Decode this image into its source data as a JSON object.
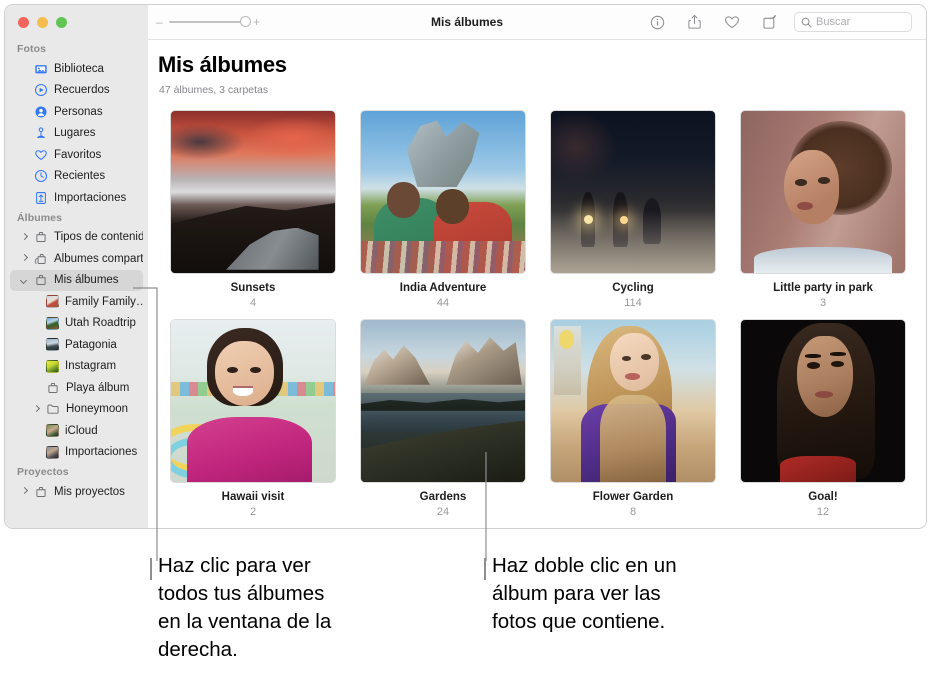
{
  "window": {
    "title": "Mis álbumes",
    "traffic_lights": [
      "close-red",
      "minimize-yellow",
      "zoom-green"
    ]
  },
  "toolbar": {
    "zoom_minus": "–",
    "zoom_plus": "+",
    "title": "Mis álbumes",
    "icons": [
      "info-icon",
      "share-icon",
      "heart-icon",
      "rotate-icon"
    ],
    "search_placeholder": "Buscar",
    "search_value": ""
  },
  "sidebar": {
    "sections": [
      {
        "header": "Fotos",
        "items": [
          {
            "label": "Biblioteca",
            "icon": "library-icon",
            "disclosure": "none",
            "indent": 0,
            "selected": false
          },
          {
            "label": "Recuerdos",
            "icon": "memories-icon",
            "disclosure": "none",
            "indent": 0,
            "selected": false
          },
          {
            "label": "Personas",
            "icon": "people-icon",
            "disclosure": "none",
            "indent": 0,
            "selected": false
          },
          {
            "label": "Lugares",
            "icon": "places-icon",
            "disclosure": "none",
            "indent": 0,
            "selected": false
          },
          {
            "label": "Favoritos",
            "icon": "favorites-icon",
            "disclosure": "none",
            "indent": 0,
            "selected": false
          },
          {
            "label": "Recientes",
            "icon": "recents-icon",
            "disclosure": "none",
            "indent": 0,
            "selected": false
          },
          {
            "label": "Importaciones",
            "icon": "imports-icon",
            "disclosure": "none",
            "indent": 0,
            "selected": false
          }
        ]
      },
      {
        "header": "Álbumes",
        "items": [
          {
            "label": "Tipos de contenido",
            "icon": "album-icon",
            "disclosure": "right",
            "indent": 0,
            "selected": false
          },
          {
            "label": "Álbumes compartidos",
            "icon": "shared-album-icon",
            "disclosure": "right",
            "indent": 0,
            "selected": false
          },
          {
            "label": "Mis álbumes",
            "icon": "album-icon",
            "disclosure": "down",
            "indent": 0,
            "selected": true
          },
          {
            "label": "Family Family…",
            "icon": "photo-thumb-icon",
            "disclosure": "none",
            "indent": 1,
            "selected": false
          },
          {
            "label": "Utah Roadtrip",
            "icon": "photo-thumb-icon",
            "disclosure": "none",
            "indent": 1,
            "selected": false
          },
          {
            "label": "Patagonia",
            "icon": "photo-thumb-icon",
            "disclosure": "none",
            "indent": 1,
            "selected": false
          },
          {
            "label": "Instagram",
            "icon": "photo-thumb-icon",
            "disclosure": "none",
            "indent": 1,
            "selected": false
          },
          {
            "label": "Playa álbum",
            "icon": "album-icon",
            "disclosure": "none",
            "indent": 1,
            "selected": false
          },
          {
            "label": "Honeymoon",
            "icon": "folder-icon",
            "disclosure": "right",
            "indent": 1,
            "selected": false
          },
          {
            "label": "iCloud",
            "icon": "photo-thumb-icon",
            "disclosure": "none",
            "indent": 1,
            "selected": false
          },
          {
            "label": "Importaciones",
            "icon": "photo-thumb-icon",
            "disclosure": "none",
            "indent": 1,
            "selected": false
          }
        ]
      },
      {
        "header": "Proyectos",
        "items": [
          {
            "label": "Mis proyectos",
            "icon": "album-icon",
            "disclosure": "right",
            "indent": 0,
            "selected": false
          }
        ]
      }
    ]
  },
  "main": {
    "page_title": "Mis álbumes",
    "page_subtitle": "47 álbumes, 3 carpetas",
    "albums": [
      {
        "name": "Sunsets",
        "count": "4",
        "thumb": "sunset-mountain-lake"
      },
      {
        "name": "India Adventure",
        "count": "44",
        "thumb": "two-boys-picnic"
      },
      {
        "name": "Cycling",
        "count": "114",
        "thumb": "night-cyclists-fog"
      },
      {
        "name": "Little party in park",
        "count": "3",
        "thumb": "woman-curly-hair-portrait"
      },
      {
        "name": "Hawaii visit",
        "count": "2",
        "thumb": "girl-pink-dress"
      },
      {
        "name": "Gardens",
        "count": "24",
        "thumb": "patagonia-mountains-lake"
      },
      {
        "name": "Flower Garden",
        "count": "8",
        "thumb": "woman-purple-blouse"
      },
      {
        "name": "Goal!",
        "count": "12",
        "thumb": "woman-dark-background"
      }
    ]
  },
  "annotations": [
    {
      "text": "Haz clic para ver\ntodos tus álbumes\nen la ventana de la\nderecha."
    },
    {
      "text": "Haz doble clic en un\nálbum para ver las\nfotos que contiene."
    }
  ],
  "colors": {
    "sidebar_bg": "#e9e9e9",
    "selection": "#d6d6d6",
    "accent_icon": "#3478f6",
    "muted_text": "#86868b",
    "callout_line": "#8e8e93"
  }
}
